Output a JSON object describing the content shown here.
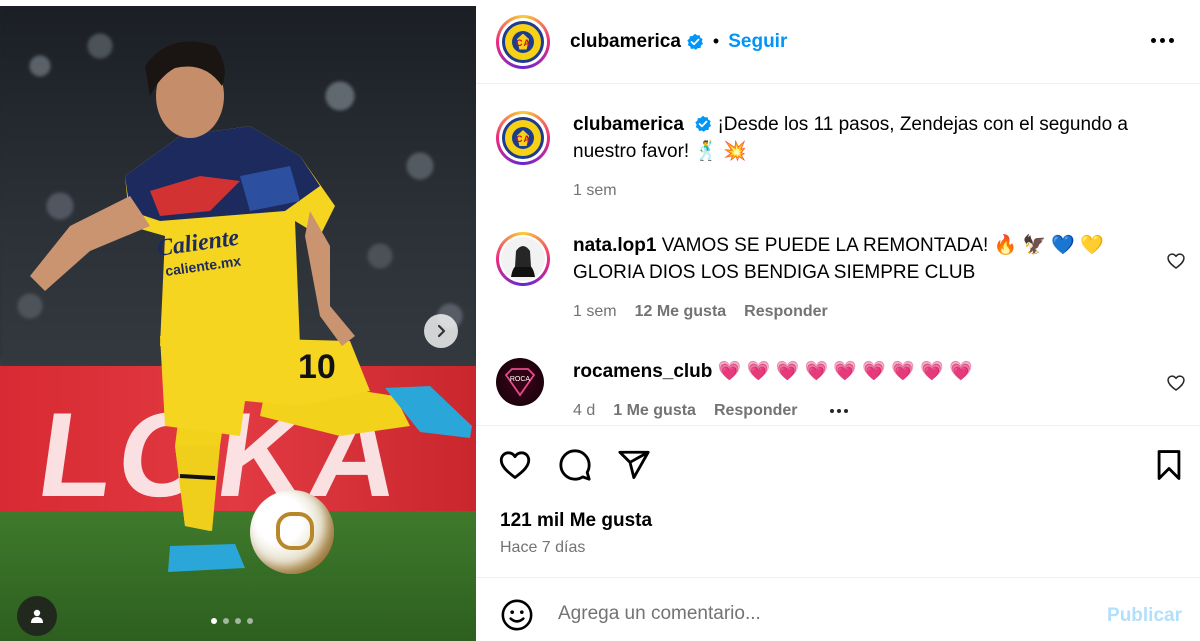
{
  "post": {
    "username": "clubamerica",
    "follow_label": "Seguir",
    "separator": "•",
    "caption": "¡Desde los 11 pasos, Zendejas con el segundo a nuestro favor! 🕺 💥",
    "caption_age": "1 sem",
    "likes": "121 mil Me gusta",
    "posted_time": "Hace 7 días"
  },
  "photo": {
    "board_text": "LOKA",
    "carousel_total": 4,
    "carousel_active": 1
  },
  "comments": [
    {
      "username": "nata.lop1",
      "text": "VAMOS SE PUEDE LA REMONTADA! 🔥 🦅 💙 💛 GLORIA DIOS LOS BENDIGA SIEMPRE CLUB",
      "age": "1 sem",
      "likes": "12 Me gusta",
      "reply_label": "Responder"
    },
    {
      "username": "rocamens_club",
      "text": "💗 💗 💗 💗 💗 💗 💗 💗 💗",
      "age": "4 d",
      "likes": "1 Me gusta",
      "reply_label": "Responder"
    }
  ],
  "add_comment": {
    "placeholder": "Agrega un comentario...",
    "post_label": "Publicar"
  },
  "colors": {
    "link_blue": "#0095f6",
    "post_disabled": "#b2dffc",
    "muted": "#737373",
    "heart_pink": "#f0306e"
  },
  "icons": [
    "verified-icon",
    "more-options-icon",
    "like-icon",
    "comment-icon",
    "share-icon",
    "save-icon",
    "emoji-icon",
    "chevron-right-icon",
    "user-tag-icon"
  ]
}
